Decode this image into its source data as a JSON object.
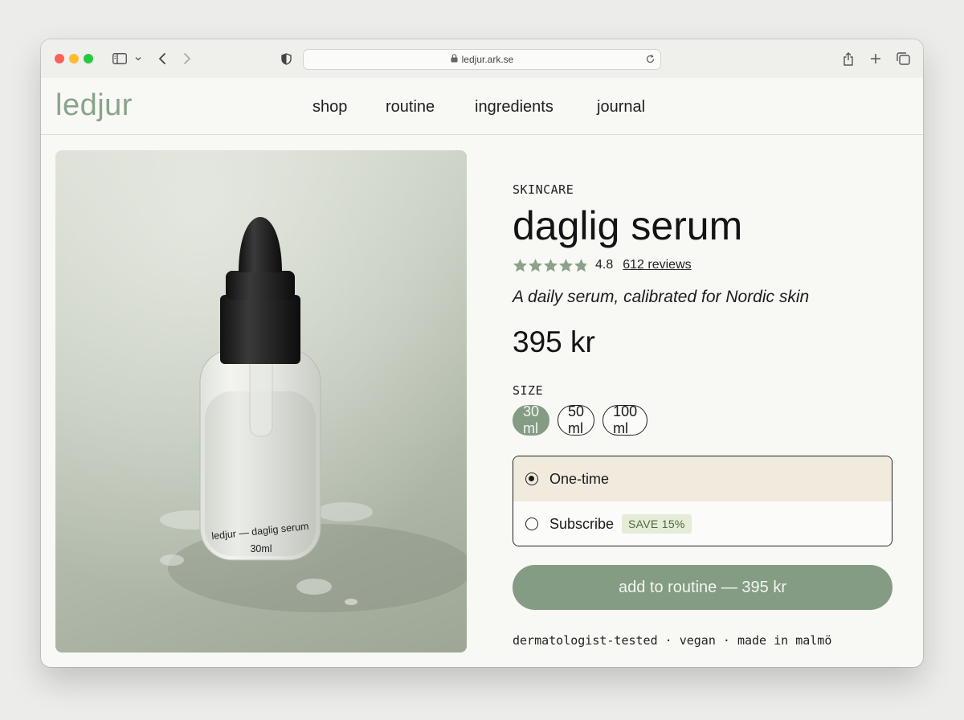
{
  "browser": {
    "url": "ledjur.ark.se"
  },
  "nav": {
    "logo": "ledjur",
    "items": [
      {
        "label": "shop"
      },
      {
        "label": "routine"
      },
      {
        "label": "ingredients"
      },
      {
        "label": "journal"
      }
    ]
  },
  "product": {
    "category": "SKINCARE",
    "name": "daglig serum",
    "rating": "4.8",
    "rating_value": 4.8,
    "rating_max": 5,
    "reviews_label": "612 reviews",
    "tagline": "A daily serum, calibrated for Nordic skin",
    "price": "395 kr",
    "bottle_label_line1": "ledjur — daglig serum",
    "bottle_label_line2": "30ml"
  },
  "size": {
    "label": "SIZE",
    "options": [
      {
        "label": "30 ml",
        "selected": true
      },
      {
        "label": "50 ml",
        "selected": false
      },
      {
        "label": "100 ml",
        "selected": false
      }
    ]
  },
  "purchase": {
    "one_time": "One-time",
    "subscribe": "Subscribe",
    "save_badge": "SAVE 15%",
    "selected": "one_time"
  },
  "cta": {
    "label": "add to routine — 395 kr"
  },
  "footnote": "dermatologist-tested · vegan · made in malmö",
  "colors": {
    "accent": "#849c84",
    "logo": "#8aa38a",
    "star": "#8aa38a",
    "one_time_bg": "#f1ebdd",
    "badge_bg": "#e5ecd7",
    "badge_text": "#4b6b3e"
  }
}
